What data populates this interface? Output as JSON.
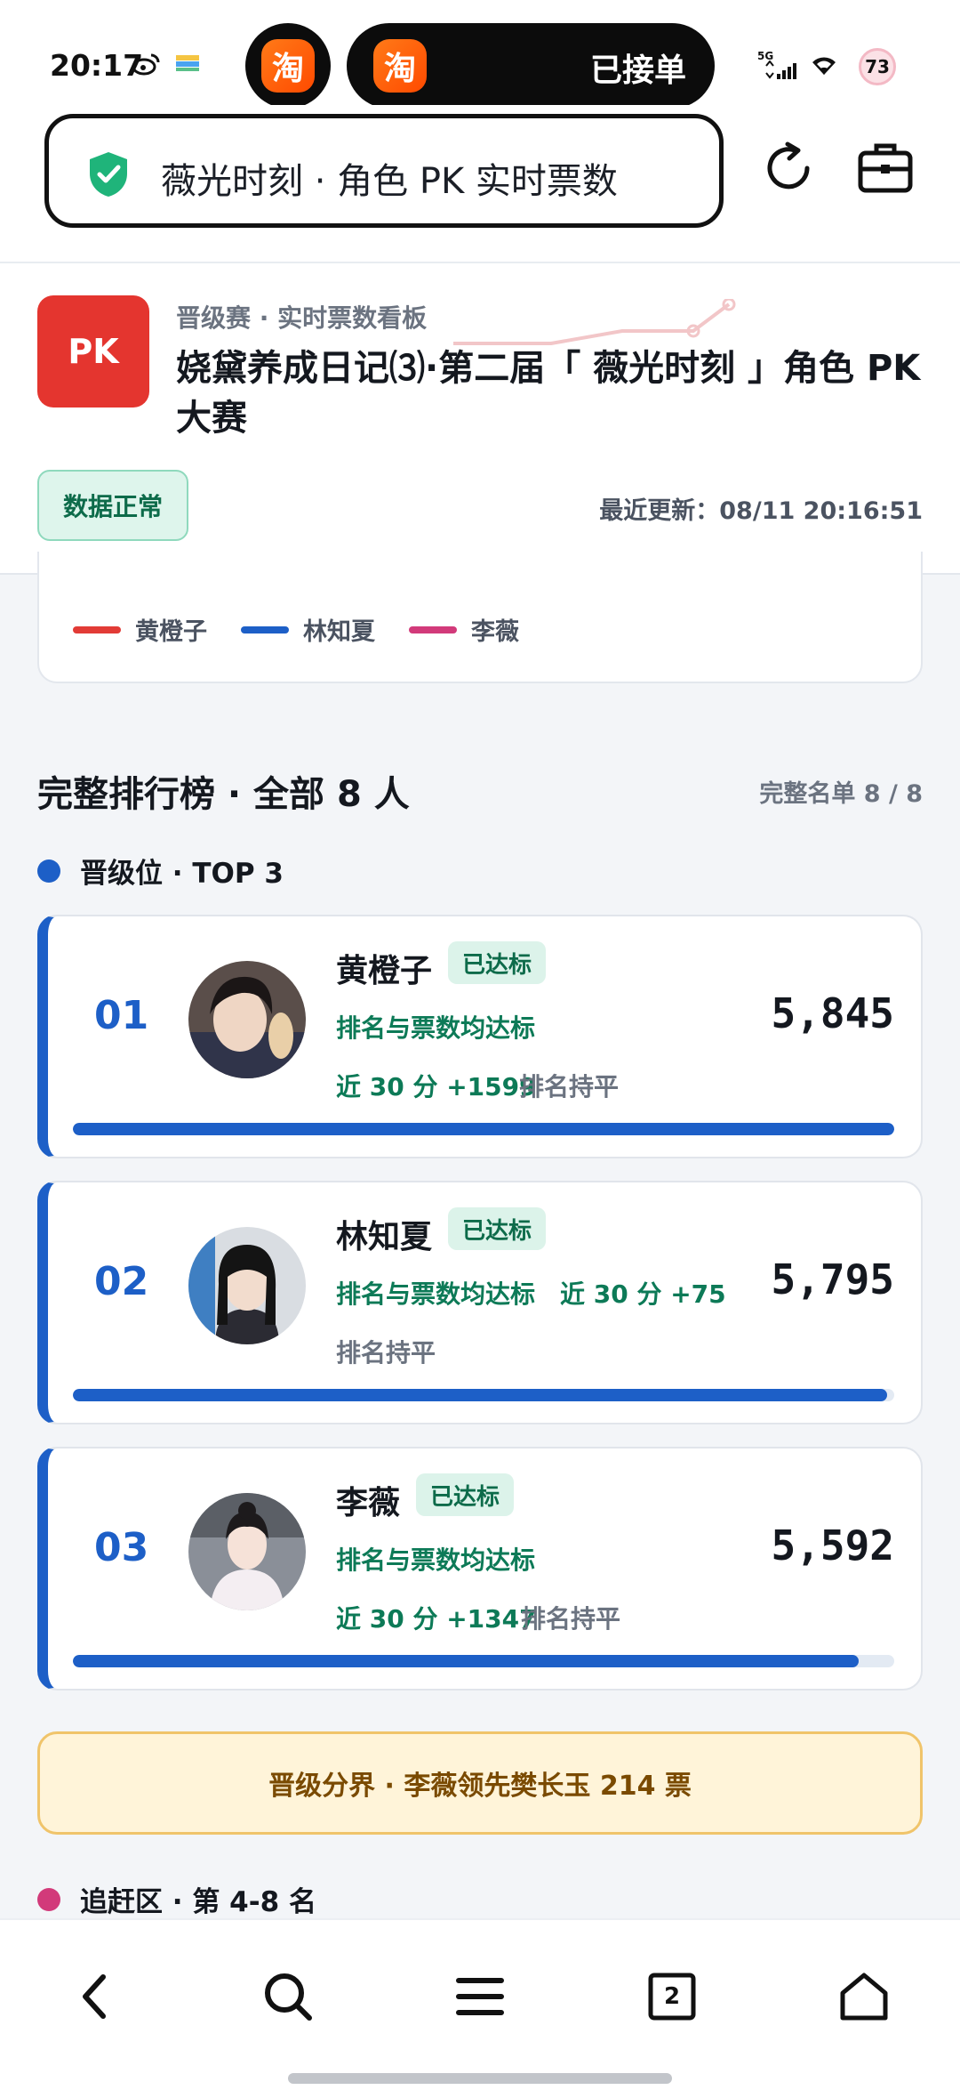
{
  "status_bar": {
    "time": "20:17",
    "taobao_glyph": "淘",
    "order_status": "已接单",
    "network": "5G",
    "battery": "73"
  },
  "browser": {
    "url_title": "薇光时刻 · 角色 PK 实时票数"
  },
  "header": {
    "logo": "PK",
    "subtitle": "晋级赛 · 实时票数看板",
    "title": "娆黛养成日记⑶·第二届「 薇光时刻 」角色 PK 大赛",
    "data_status": "数据正常",
    "last_update_label": "最近更新：",
    "last_update_time": "08/11 20:16:51"
  },
  "chart_legend": [
    {
      "name": "黄橙子",
      "color": "#e23b36"
    },
    {
      "name": "林知夏",
      "color": "#1d5fc7"
    },
    {
      "name": "李薇",
      "color": "#d23a7a"
    }
  ],
  "ranking": {
    "title": "完整排行榜 · 全部 8 人",
    "count": "完整名单 8 / 8",
    "top_group": "晋级位 · TOP 3",
    "chase_group": "追赶区 · 第 4-8 名",
    "entries": [
      {
        "rank": "01",
        "name": "黄橙子",
        "badge": "已达标",
        "status": "排名与票数均达标",
        "trend": "近 30 分 +1599",
        "hold": "排名持平",
        "votes": "5,845",
        "progress": 1.0
      },
      {
        "rank": "02",
        "name": "林知夏",
        "badge": "已达标",
        "status": "排名与票数均达标",
        "trend": "近 30 分 +75",
        "hold": "排名持平",
        "votes": "5,795",
        "progress": 0.991
      },
      {
        "rank": "03",
        "name": "李薇",
        "badge": "已达标",
        "status": "排名与票数均达标",
        "trend": "近 30 分 +1347",
        "hold": "排名持平",
        "votes": "5,592",
        "progress": 0.957
      }
    ],
    "boundary": "晋级分界 · 李薇领先樊长玉 214 票"
  },
  "nav": {
    "tab_count": "2"
  },
  "colors": {
    "accent_blue": "#1d5fc7",
    "success_green": "#0d7a57",
    "pk_red": "#e4352f",
    "warning_bg": "#fff4d9"
  }
}
